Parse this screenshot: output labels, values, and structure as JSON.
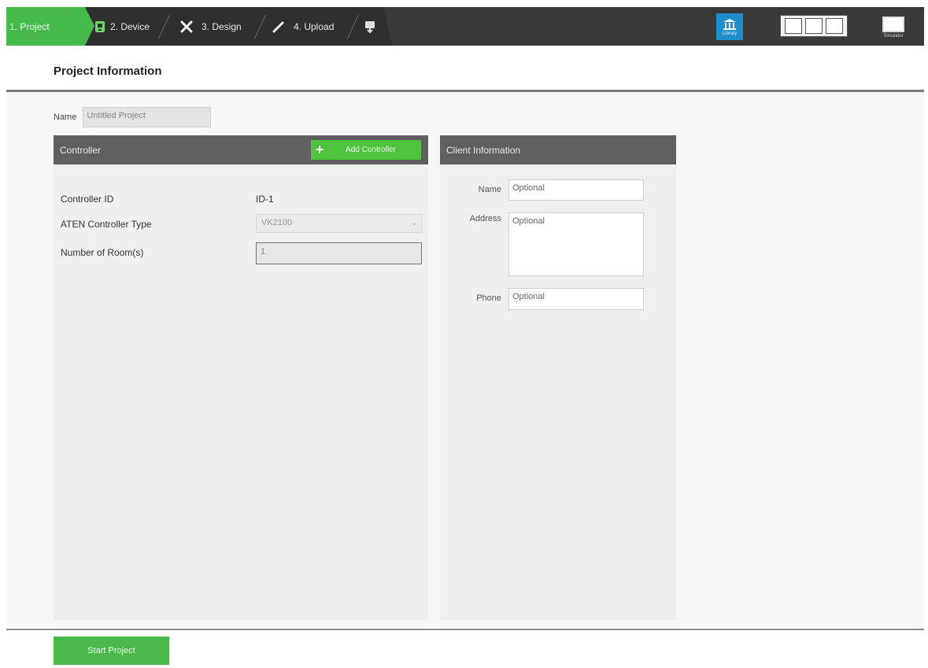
{
  "toolbar": {
    "steps": [
      {
        "label": "1. Project",
        "icon": "project-icon"
      },
      {
        "label": "2. Device",
        "icon": "device-icon"
      },
      {
        "label": "3. Design",
        "icon": "design-tools-icon"
      },
      {
        "label": "4. Upload",
        "icon": "brush-icon"
      }
    ],
    "library_label": "Library",
    "simulator_label": "Simulator",
    "colors": {
      "active_step": "#46b94b",
      "library": "#1e8fc9",
      "bar": "#3a3a3a"
    }
  },
  "page": {
    "title": "Project Information",
    "name_label": "Name",
    "name_placeholder": "Untitled Project"
  },
  "controller": {
    "header": "Controller",
    "add_button": "Add Controller",
    "id_label": "Controller ID",
    "id_value": "ID-1",
    "type_label": "ATEN Controller Type",
    "type_value": "VK2100",
    "rooms_label": "Number of Room(s)",
    "rooms_value": "1"
  },
  "client": {
    "header": "Client Information",
    "name_label": "Name",
    "name_placeholder": "Optional",
    "address_label": "Address",
    "address_placeholder": "Optional",
    "phone_label": "Phone",
    "phone_placeholder": "Optional"
  },
  "footer": {
    "start_button": "Start Project",
    "color": "#4ab84a"
  }
}
